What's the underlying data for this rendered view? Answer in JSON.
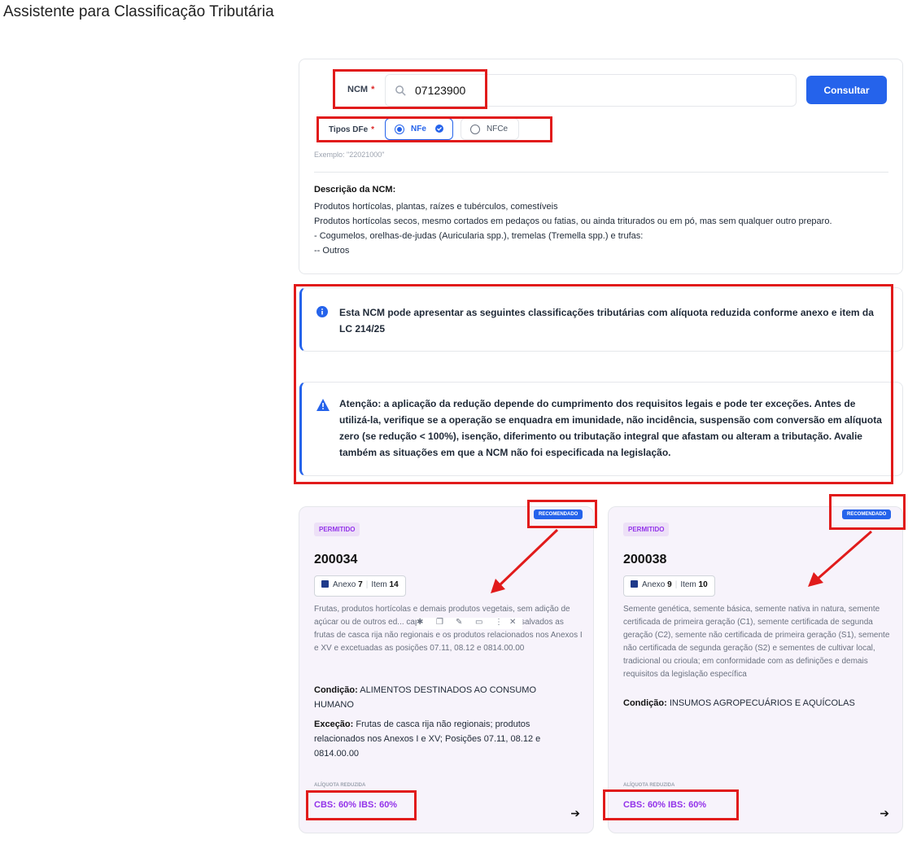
{
  "page": {
    "title": "Assistente para Classificação Tributária"
  },
  "search": {
    "ncm_label": "NCM",
    "required_mark": "*",
    "ncm_value": "07123900",
    "consult_label": "Consultar",
    "dfe_label": "Tipos DFe",
    "dfe_options": [
      {
        "label": "NFe",
        "selected": true
      },
      {
        "label": "NFCe",
        "selected": false
      }
    ],
    "example": "Exemplo: \"22021000\""
  },
  "description": {
    "title": "Descrição da NCM:",
    "lines": [
      "Produtos hortícolas, plantas, raízes e tubérculos, comestíveis",
      "Produtos hortícolas secos, mesmo cortados em pedaços ou fatias, ou ainda triturados ou em pó, mas sem qualquer outro preparo.",
      "- Cogumelos, orelhas-de-judas (Auricularia spp.), tremelas (Tremella spp.) e trufas:",
      "-- Outros"
    ]
  },
  "alerts": {
    "info": "Esta NCM pode apresentar as seguintes classificações tributárias com alíquota reduzida conforme anexo e item da LC 214/25",
    "warning": "Atenção: a aplicação da redução depende do cumprimento dos requisitos legais e pode ter exceções. Antes de utilizá-la, verifique se a operação se enquadra em imunidade, não incidência, suspensão com conversão em alíquota zero (se redução < 100%), isenção, diferimento ou tributação integral que afastam ou alteram a tributação. Avalie também as situações em que a NCM não foi especificada na legislação."
  },
  "cards": [
    {
      "status": "PERMITIDO",
      "recommended": "RECOMENDADO",
      "code": "200034",
      "annex_label": "Anexo",
      "annex": "7",
      "item_label": "Item",
      "item": "14",
      "description": "Frutas, produtos hortícolas e demais produtos vegetais, sem adição de açúcar ou de outros ed... capítulos 7 e 8 da NCM/SH, ressalvados as frutas de casca rija não regionais e os produtos relacionados nos Anexos I e XV e excetuadas as posições 07.11, 08.12 e 0814.00.00",
      "condition_label": "Condição:",
      "condition": "ALIMENTOS DESTINADOS AO CONSUMO HUMANO",
      "exception_label": "Exceção:",
      "exception": "Frutas de casca rija não regionais; produtos relacionados nos Anexos I e XV; Posições 07.11, 08.12 e 0814.00.00",
      "rate_label": "ALÍQUOTA REDUZIDA",
      "rate": "CBS: 60% IBS: 60%"
    },
    {
      "status": "PERMITIDO",
      "recommended": "RECOMENDADO",
      "code": "200038",
      "annex_label": "Anexo",
      "annex": "9",
      "item_label": "Item",
      "item": "10",
      "description": "Semente genética, semente básica, semente nativa in natura, semente certificada de primeira geração (C1), semente certificada de segunda geração (C2), semente não certificada de primeira geração (S1), semente não certificada de segunda geração (S2) e sementes de cultivar local, tradicional ou crioula; em conformidade com as definições e demais requisitos da legislação específica",
      "condition_label": "Condição:",
      "condition": "INSUMOS AGROPECUÁRIOS E AQUÍCOLAS",
      "rate_label": "ALÍQUOTA REDUZIDA",
      "rate": "CBS: 60% IBS: 60%"
    }
  ],
  "icons": {
    "search": "search-icon",
    "info": "info-icon",
    "warning": "warning-icon",
    "book": "book-icon",
    "next": "arrow-right-icon",
    "check": "check-circle-icon"
  },
  "colors": {
    "primary": "#2563eb",
    "permitted": "#9333ea",
    "annotation": "#e11b1b"
  }
}
